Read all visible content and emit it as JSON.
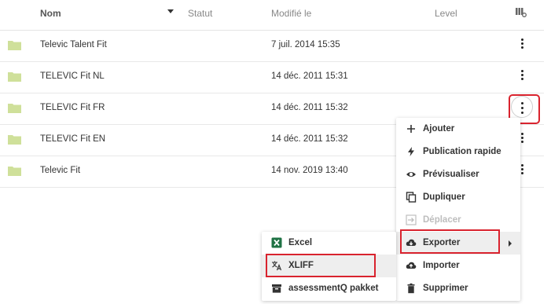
{
  "table": {
    "headers": {
      "name": "Nom",
      "status": "Statut",
      "modified": "Modifié le",
      "level": "Level"
    },
    "rows": [
      {
        "name": "Televic Talent Fit",
        "modified": "7 juil. 2014 15:35"
      },
      {
        "name": "TELEVIC Fit NL",
        "modified": "14 déc. 2011 15:31"
      },
      {
        "name": "TELEVIC Fit FR",
        "modified": "14 déc. 2011 15:32"
      },
      {
        "name": "TELEVIC Fit EN",
        "modified": "14 déc. 2011 15:32"
      },
      {
        "name": "Televic Fit",
        "modified": "14 nov. 2019 13:40"
      }
    ]
  },
  "context_menu": {
    "items": [
      {
        "label": "Ajouter",
        "icon": "plus-icon"
      },
      {
        "label": "Publication rapide",
        "icon": "lightning-icon"
      },
      {
        "label": "Prévisualiser",
        "icon": "eye-icon"
      },
      {
        "label": "Dupliquer",
        "icon": "copy-icon"
      },
      {
        "label": "Déplacer",
        "icon": "move-icon",
        "disabled": true
      },
      {
        "label": "Exporter",
        "icon": "cloud-download-icon",
        "has_submenu": true
      },
      {
        "label": "Importer",
        "icon": "cloud-upload-icon"
      },
      {
        "label": "Supprimer",
        "icon": "trash-icon"
      }
    ]
  },
  "export_submenu": {
    "items": [
      {
        "label": "Excel",
        "icon": "excel-icon"
      },
      {
        "label": "XLIFF",
        "icon": "translate-icon"
      },
      {
        "label": "assessmentQ pakket",
        "icon": "package-icon"
      }
    ]
  },
  "colors": {
    "folder": "#cfe09a",
    "highlight": "#d9232e",
    "excel": "#1f7244"
  }
}
